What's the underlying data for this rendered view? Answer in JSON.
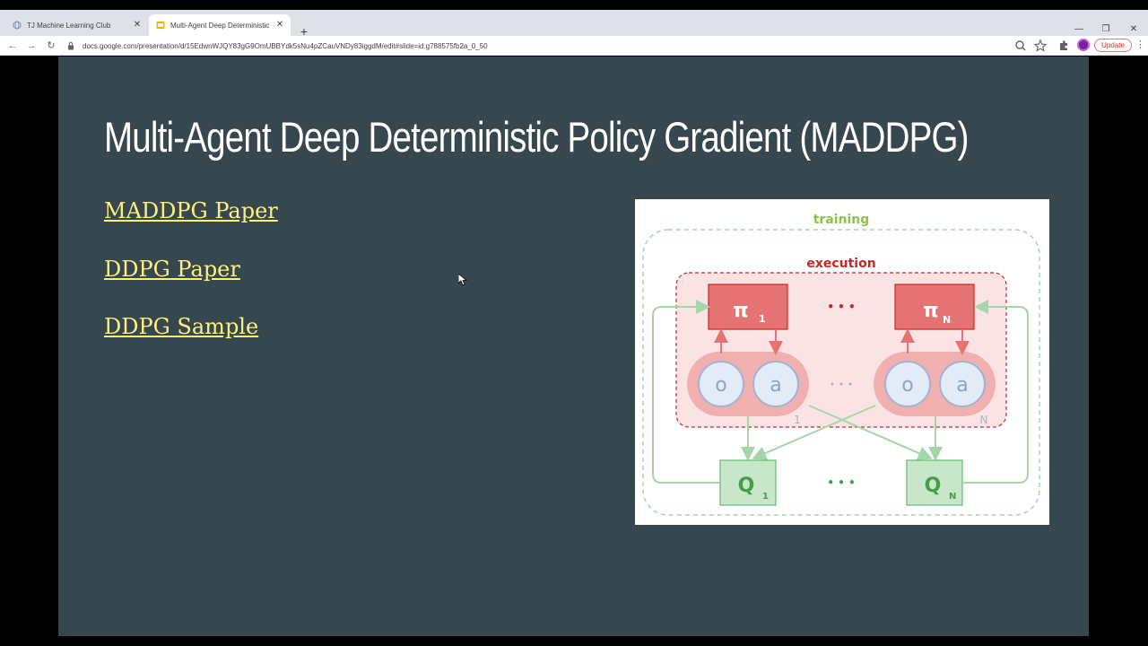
{
  "browser": {
    "tabs": [
      {
        "title": "TJ Machine Learning Club"
      },
      {
        "title": "Multi-Agent Deep Deterministic"
      }
    ],
    "url": "docs.google.com/presentation/d/15EdwnWJQY83gG9OmUBBYdk5sNu4pZCauVNDy83iggdM/edit#slide=id.g788575fb2a_0_50",
    "update_label": "Update"
  },
  "slide": {
    "title": "Multi-Agent Deep Deterministic Policy Gradient (MADDPG)",
    "links": [
      {
        "label": "MADDPG Paper"
      },
      {
        "label": "DDPG Paper"
      },
      {
        "label": "DDPG Sample"
      }
    ],
    "diagram": {
      "training_label": "training",
      "execution_label": "execution",
      "pi_symbol": "π",
      "pi_sub_first": "1",
      "pi_sub_last": "N",
      "obs_label": "o",
      "act_label": "a",
      "group_first": "1",
      "group_last": "N",
      "q_label": "Q",
      "q_sub_first": "1",
      "q_sub_last": "N",
      "ellipsis": "• • •"
    }
  },
  "colors": {
    "slide_bg": "#37474f",
    "link": "#fff176",
    "training": "#8bc34a",
    "execution": "#c62828"
  }
}
